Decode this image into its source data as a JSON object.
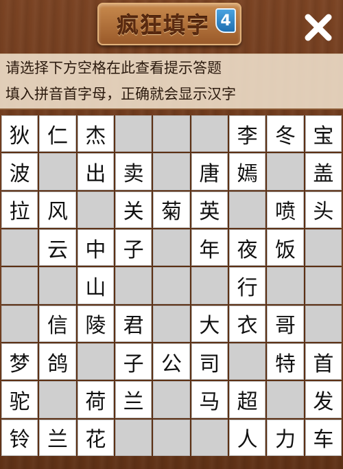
{
  "header": {
    "title": "疯狂填字",
    "level_badge": "4",
    "close_label": "×"
  },
  "hints": {
    "line1": "请选择下方空格在此查看提示答题",
    "line2": "填入拼音首字母，正确就会显示汉字"
  },
  "colors": {
    "wood": "#6b3a1f",
    "cell_white": "#ffffff",
    "cell_gray": "#cfcfcf",
    "hint_bg": "#f0e1cd"
  },
  "grid": {
    "rows": [
      [
        {
          "t": "狄",
          "s": "w"
        },
        {
          "t": "仁",
          "s": "w"
        },
        {
          "t": "杰",
          "s": "w"
        },
        {
          "t": "",
          "s": "g"
        },
        {
          "t": "",
          "s": "g"
        },
        {
          "t": "",
          "s": "g"
        },
        {
          "t": "李",
          "s": "w"
        },
        {
          "t": "冬",
          "s": "w"
        },
        {
          "t": "宝",
          "s": "w"
        }
      ],
      [
        {
          "t": "波",
          "s": "w"
        },
        {
          "t": "",
          "s": "g"
        },
        {
          "t": "出",
          "s": "w"
        },
        {
          "t": "卖",
          "s": "w"
        },
        {
          "t": "",
          "s": "g"
        },
        {
          "t": "唐",
          "s": "w"
        },
        {
          "t": "嫣",
          "s": "w"
        },
        {
          "t": "",
          "s": "g"
        },
        {
          "t": "盖",
          "s": "w"
        }
      ],
      [
        {
          "t": "拉",
          "s": "w"
        },
        {
          "t": "风",
          "s": "w"
        },
        {
          "t": "",
          "s": "g"
        },
        {
          "t": "关",
          "s": "w"
        },
        {
          "t": "菊",
          "s": "w"
        },
        {
          "t": "英",
          "s": "w"
        },
        {
          "t": "",
          "s": "g"
        },
        {
          "t": "喷",
          "s": "w"
        },
        {
          "t": "头",
          "s": "w"
        }
      ],
      [
        {
          "t": "",
          "s": "g"
        },
        {
          "t": "云",
          "s": "w"
        },
        {
          "t": "中",
          "s": "w"
        },
        {
          "t": "子",
          "s": "w"
        },
        {
          "t": "",
          "s": "g"
        },
        {
          "t": "年",
          "s": "w"
        },
        {
          "t": "夜",
          "s": "w"
        },
        {
          "t": "饭",
          "s": "w"
        },
        {
          "t": "",
          "s": "g"
        }
      ],
      [
        {
          "t": "",
          "s": "g"
        },
        {
          "t": "",
          "s": "g"
        },
        {
          "t": "山",
          "s": "w"
        },
        {
          "t": "",
          "s": "g"
        },
        {
          "t": "",
          "s": "g"
        },
        {
          "t": "",
          "s": "g"
        },
        {
          "t": "行",
          "s": "w"
        },
        {
          "t": "",
          "s": "g"
        },
        {
          "t": "",
          "s": "g"
        }
      ],
      [
        {
          "t": "",
          "s": "g"
        },
        {
          "t": "信",
          "s": "w"
        },
        {
          "t": "陵",
          "s": "w"
        },
        {
          "t": "君",
          "s": "w"
        },
        {
          "t": "",
          "s": "g"
        },
        {
          "t": "大",
          "s": "w"
        },
        {
          "t": "衣",
          "s": "w"
        },
        {
          "t": "哥",
          "s": "w"
        },
        {
          "t": "",
          "s": "g"
        }
      ],
      [
        {
          "t": "梦",
          "s": "w"
        },
        {
          "t": "鸽",
          "s": "w"
        },
        {
          "t": "",
          "s": "g"
        },
        {
          "t": "子",
          "s": "w"
        },
        {
          "t": "公",
          "s": "w"
        },
        {
          "t": "司",
          "s": "w"
        },
        {
          "t": "",
          "s": "g"
        },
        {
          "t": "特",
          "s": "w"
        },
        {
          "t": "首",
          "s": "w"
        }
      ],
      [
        {
          "t": "驼",
          "s": "w"
        },
        {
          "t": "",
          "s": "g"
        },
        {
          "t": "荷",
          "s": "w"
        },
        {
          "t": "兰",
          "s": "w"
        },
        {
          "t": "",
          "s": "g"
        },
        {
          "t": "马",
          "s": "w"
        },
        {
          "t": "超",
          "s": "w"
        },
        {
          "t": "",
          "s": "g"
        },
        {
          "t": "发",
          "s": "w"
        }
      ],
      [
        {
          "t": "铃",
          "s": "w"
        },
        {
          "t": "兰",
          "s": "w"
        },
        {
          "t": "花",
          "s": "w"
        },
        {
          "t": "",
          "s": "g"
        },
        {
          "t": "",
          "s": "g"
        },
        {
          "t": "",
          "s": "g"
        },
        {
          "t": "人",
          "s": "w"
        },
        {
          "t": "力",
          "s": "w"
        },
        {
          "t": "车",
          "s": "w"
        }
      ]
    ]
  }
}
